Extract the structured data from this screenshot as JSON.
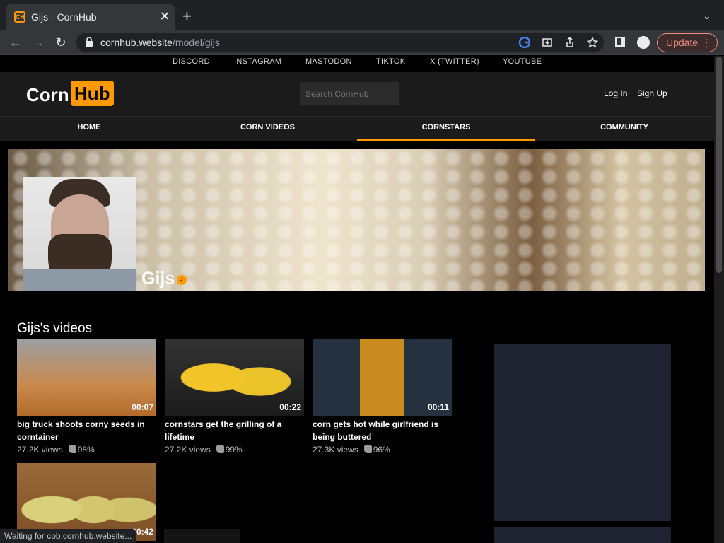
{
  "browser": {
    "tab_title": "Gijs - CornHub",
    "favicon_text": "CH",
    "close_glyph": "✕",
    "newtab_glyph": "+",
    "tablist_glyph": "⌄",
    "back_glyph": "←",
    "forward_glyph": "→",
    "reload_glyph": "↻",
    "url_host": "cornhub.website",
    "url_path": "/model/gijs",
    "update_label": "Update",
    "menu_glyph": "⋮",
    "icons": [
      "google-icon",
      "install-icon",
      "share-icon",
      "star-icon",
      "side-panel-icon",
      "profile-icon"
    ]
  },
  "social": [
    "DISCORD",
    "INSTAGRAM",
    "MASTODON",
    "TIKTOK",
    "X (TWITTER)",
    "YOUTUBE"
  ],
  "header": {
    "logo_corn": "Corn",
    "logo_hub": "Hub",
    "search_placeholder": "Search CornHub",
    "login": "Log In",
    "signup": "Sign Up"
  },
  "nav": {
    "items": [
      "HOME",
      "CORN VIDEOS",
      "CORNSTARS",
      "COMMUNITY"
    ],
    "active": "CORNSTARS",
    "accent": "#ff9900"
  },
  "profile": {
    "name": "Gijs",
    "verified_glyph": "✓"
  },
  "videos": {
    "title": "Gijs's videos",
    "items": [
      {
        "duration": "00:07",
        "title": "big truck shoots corny seeds in corntainer",
        "views": "27.2K views",
        "rating": "98%"
      },
      {
        "duration": "00:22",
        "title": "cornstars get the grilling of a lifetime",
        "views": "27.2K views",
        "rating": "99%"
      },
      {
        "duration": "00:11",
        "title": "corn gets hot while girlfriend is being buttered",
        "views": "27.3K views",
        "rating": "96%"
      },
      {
        "duration": "00:42"
      }
    ]
  },
  "status": "Waiting for cob.cornhub.website..."
}
